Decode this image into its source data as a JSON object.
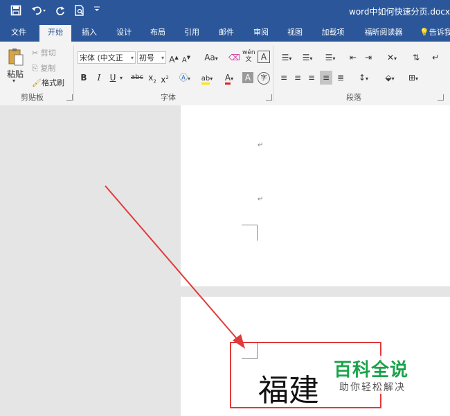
{
  "window": {
    "title": "word中如何快速分页.docx"
  },
  "qat": {
    "save_icon": "floppy-disk",
    "undo_icon": "undo-arrow",
    "redo_icon": "redo-arrow",
    "preview_icon": "print-preview",
    "more": "more-dropdown"
  },
  "tabs": [
    {
      "label": "文件"
    },
    {
      "label": "开始"
    },
    {
      "label": "插入"
    },
    {
      "label": "设计"
    },
    {
      "label": "布局"
    },
    {
      "label": "引用"
    },
    {
      "label": "邮件"
    },
    {
      "label": "审阅"
    },
    {
      "label": "视图"
    },
    {
      "label": "加载项"
    },
    {
      "label": "福昕阅读器"
    },
    {
      "label": "告诉我"
    }
  ],
  "clipboard": {
    "paste": "粘贴",
    "cut": "剪切",
    "copy": "复制",
    "format_painter": "格式刷",
    "label": "剪贴板"
  },
  "font": {
    "font_name": "宋体 (中文正",
    "font_size": "初号",
    "grow": "A",
    "shrink": "A",
    "case": "Aa",
    "bold": "B",
    "italic": "I",
    "underline": "U",
    "strike": "abc",
    "sub": "x",
    "sup": "x",
    "label": "字体"
  },
  "paragraph": {
    "label": "段落"
  },
  "document": {
    "para_mark": "↵",
    "content": "福建"
  },
  "watermark": {
    "title": "百科全说",
    "subtitle": "助你轻松解决"
  },
  "colors": {
    "accent": "#2b579a",
    "annotation": "#e03a3a",
    "watermark": "#1aa34a"
  }
}
